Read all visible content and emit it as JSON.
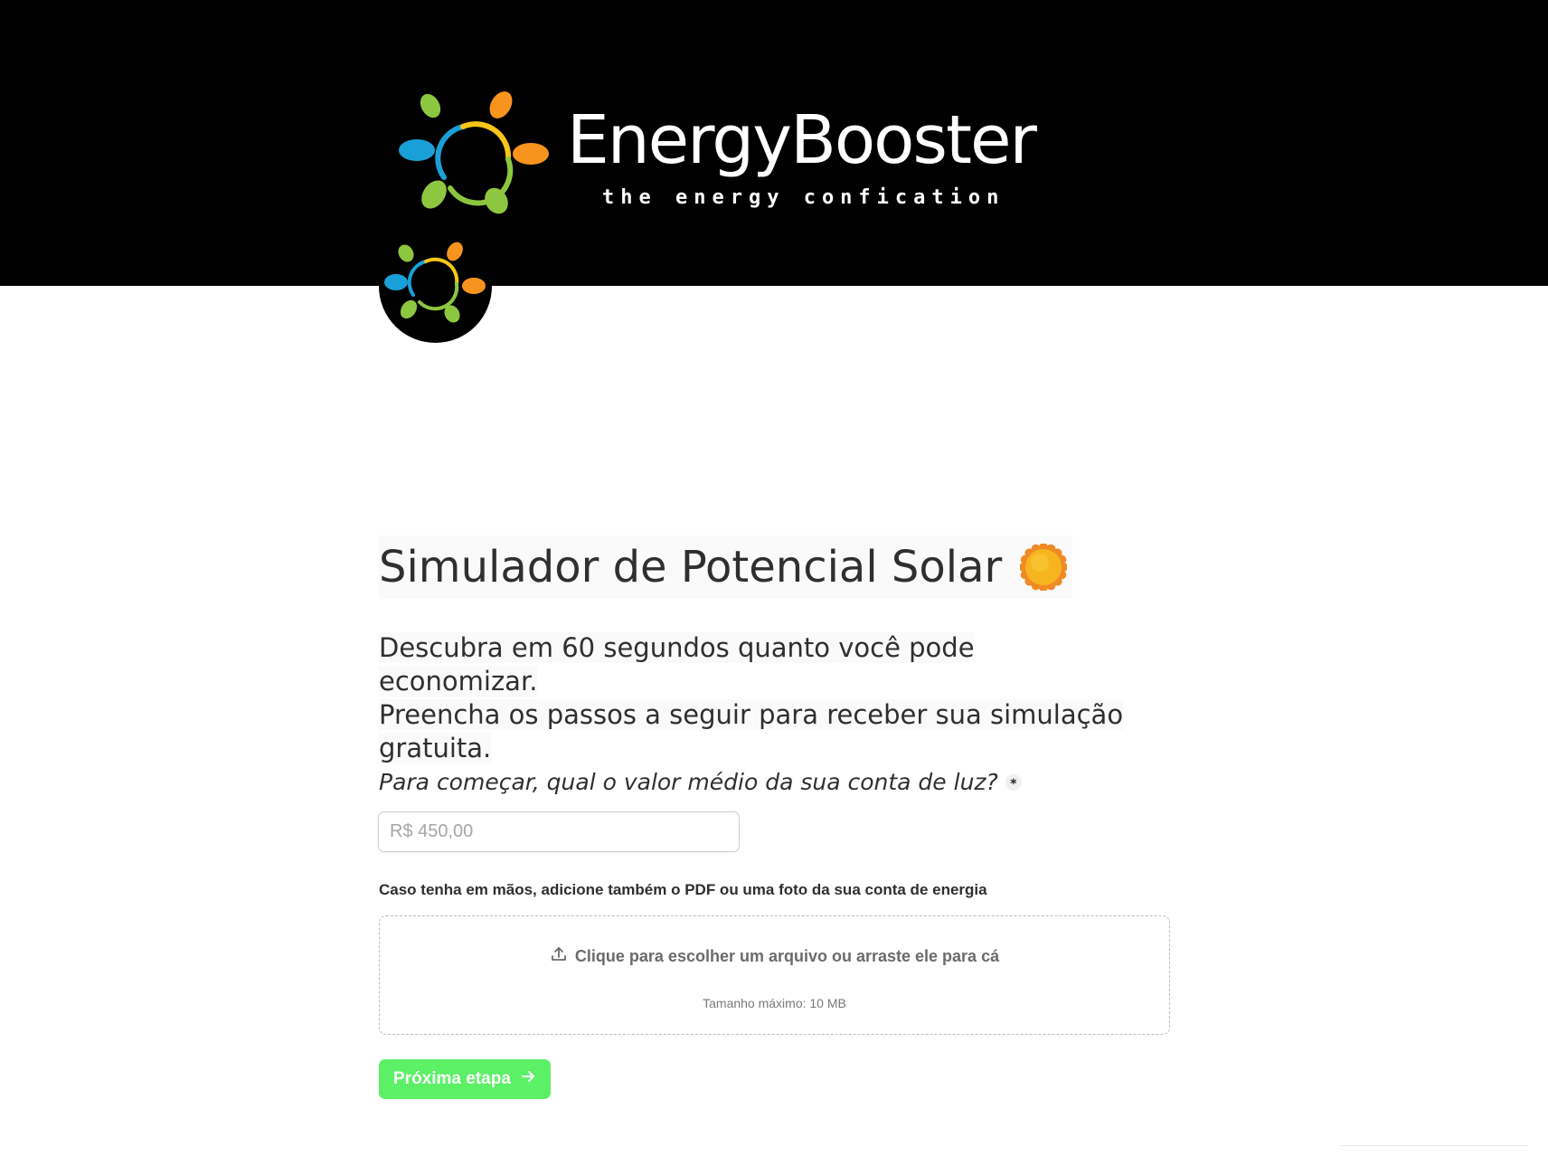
{
  "brand": {
    "name": "EnergyBooster",
    "tagline": "the energy confication",
    "colors": {
      "blue": "#1aa0d8",
      "orange": "#f7941d",
      "green": "#8dc63f",
      "yellow": "#f5c518",
      "background": "#000000"
    }
  },
  "header": {
    "title": "Simulador de Potencial Solar",
    "title_icon": "sun-icon"
  },
  "intro": {
    "line1": "Descubra em 60 segundos quanto você pode economizar.",
    "line2": "Preencha os passos a seguir para receber sua simulação gratuita."
  },
  "form": {
    "bill_question": "Para começar, qual o valor médio da sua conta de luz?",
    "required_mark": "*",
    "bill_placeholder": "R$ 450,00",
    "bill_value": "",
    "upload_label": "Caso tenha em mãos, adicione também o PDF ou uma foto da sua conta de energia",
    "upload_prompt": "Clique para escolher um arquivo ou arraste ele para cá",
    "upload_icon": "upload-icon",
    "upload_limit": "Tamanho máximo: 10 MB",
    "next_label": "Próxima etapa",
    "next_icon": "arrow-right-icon",
    "next_color": "#5cf067"
  }
}
